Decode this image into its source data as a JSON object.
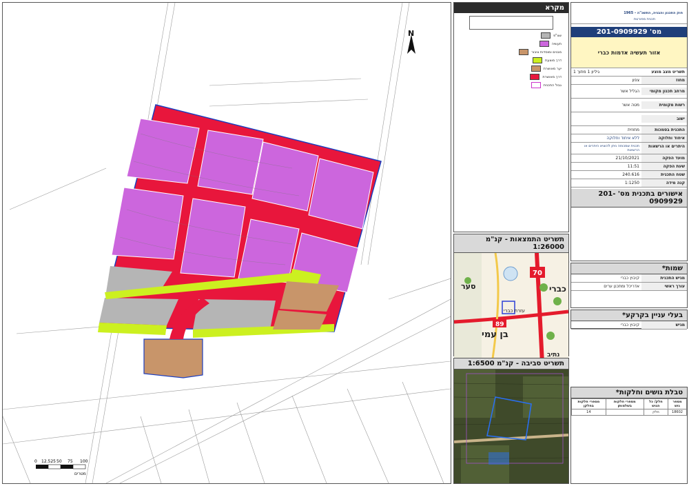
{
  "colors": {
    "road": "#e8163c",
    "industry": "#cc66dd",
    "open_space": "#b5b5b5",
    "green": "#ccf020",
    "engineering": "#c8956a",
    "boundary": "#1b3dbf"
  },
  "map": {
    "north_label": "N",
    "scale_bar": {
      "ticks": [
        "0",
        "12.525",
        "50",
        "75",
        "100"
      ],
      "unit": "מטרים"
    }
  },
  "legend": {
    "title": "מקרא",
    "items": [
      {
        "label": "שצ\"פ",
        "color": "#b5b5b5"
      },
      {
        "label": "תעשיה",
        "color": "#cc66dd"
      },
      {
        "label": "מבנים ומוסדות ציבור",
        "color": "#c8956a"
      },
      {
        "label": "דרך מוצעת",
        "color": "#ccf020"
      },
      {
        "label": "יער מאושרת",
        "color": "#c8956a"
      },
      {
        "label": "דרך מאושרת",
        "color": "#e8163c"
      },
      {
        "label": "גבול התכנית",
        "color": "#ffffff"
      }
    ]
  },
  "header": {
    "law_line": "חוק התכנון והבניה, התשכ\"ה - 1965",
    "doc_type": "תכנית מפורטת",
    "plan_number_label": "מס' 201-0909929",
    "plan_name": "אזור תעשיה אדמות כברי",
    "meta_line": "תשריט מצב מוצע",
    "sheet_label": "גיליון 1 מתוך 1"
  },
  "info": [
    {
      "k": "מחוז",
      "v": "צפון"
    },
    {
      "k": "מרחב תכנון מקומי",
      "v": "הגליל אשר"
    },
    {
      "k": "רשות מקומית",
      "v": "מטה אשר"
    },
    {
      "k": "ישוב",
      "v": ""
    },
    {
      "k": "התכנית בסמכות",
      "v": "מחוזית"
    },
    {
      "k": "איחוד וחלוקה",
      "v": "ללא איחוד וחלוקה"
    },
    {
      "k": "היתרים או הרשאות",
      "v": "תכנית שמכוחה ניתן להוציא היתרים או הרשאות"
    },
    {
      "k": "מועד הפקה",
      "v": "21/10/2021"
    },
    {
      "k": "שעת הפקה",
      "v": "11:51"
    },
    {
      "k": "שטח התכנית",
      "v": "240.616"
    },
    {
      "k": "קנה מידה",
      "v": "1:1250"
    }
  ],
  "approvals": {
    "title": "אישורים בתכנית מס' 201-0909929"
  },
  "location_map": {
    "title": "תשריט התמצאות - קנ\"מ 1:26000",
    "labels": [
      {
        "text": "סער"
      },
      {
        "text": "כברי"
      },
      {
        "text": "בן עמי"
      },
      {
        "text": "עזרת כברי"
      },
      {
        "text": "נתיב"
      },
      {
        "text": "70"
      },
      {
        "text": "89"
      }
    ]
  },
  "surroundings_map": {
    "title": "תשריט סביבה - קנ\"מ 1:6500"
  },
  "names": {
    "title": "שמות*",
    "rows": [
      {
        "k": "מגיש התכנית",
        "v": "קיבוץ כברי"
      },
      {
        "k": "עורך ראשי",
        "v": "אדריכל ומתכנן ערים"
      }
    ]
  },
  "owners": {
    "title": "בעלי עניין בקרקע*",
    "rows": [
      {
        "k": "מגיש",
        "v": "קיבוץ כברי"
      }
    ]
  },
  "parcels": {
    "title": "טבלת גושים וחלקות*",
    "headers": [
      "מספר גוש",
      "חלק/ כל הגוש",
      "מספרי חלקות בשלמותן",
      "מספרי חלקות בחלקן"
    ],
    "rows": [
      [
        "18602",
        "חלק",
        "",
        "14"
      ]
    ]
  }
}
